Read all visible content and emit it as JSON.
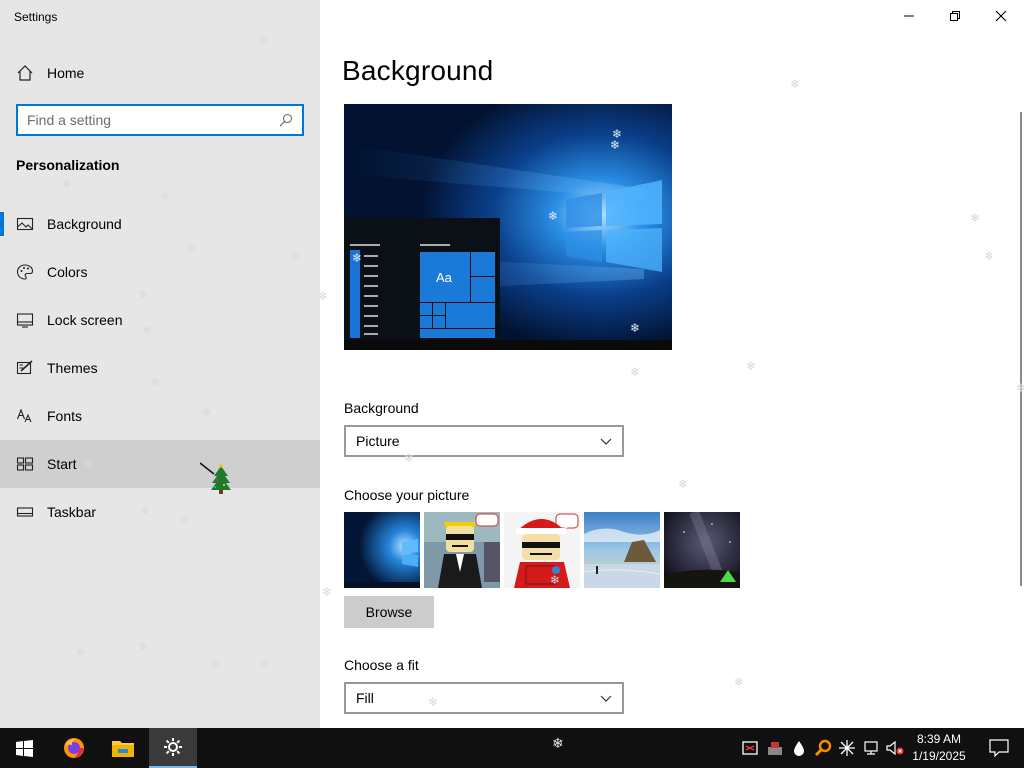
{
  "window": {
    "title": "Settings"
  },
  "sidebar": {
    "home_label": "Home",
    "search_placeholder": "Find a setting",
    "section_title": "Personalization",
    "items": [
      {
        "label": "Background",
        "icon": "picture-icon",
        "active": true
      },
      {
        "label": "Colors",
        "icon": "palette-icon"
      },
      {
        "label": "Lock screen",
        "icon": "lock-screen-icon"
      },
      {
        "label": "Themes",
        "icon": "brush-icon"
      },
      {
        "label": "Fonts",
        "icon": "fonts-icon"
      },
      {
        "label": "Start",
        "icon": "start-tiles-icon",
        "hover": true
      },
      {
        "label": "Taskbar",
        "icon": "taskbar-icon"
      }
    ]
  },
  "main": {
    "page_title": "Background",
    "background_label": "Background",
    "background_value": "Picture",
    "choose_picture_label": "Choose your picture",
    "thumbnails": [
      "windows-hero",
      "comic-character-suit",
      "comic-character-santa",
      "beach-sunset",
      "night-sky-tent"
    ],
    "browse_label": "Browse",
    "fit_label": "Choose a fit",
    "fit_value": "Fill",
    "preview_tile_text": "Aa"
  },
  "taskbar": {
    "time": "8:39 AM",
    "date": "1/19/2025",
    "apps": [
      "start-icon",
      "firefox-icon",
      "file-explorer-icon",
      "settings-icon"
    ],
    "tray": [
      "app-tray-icon",
      "network-app-icon",
      "droplet-icon",
      "search-magnifier-icon",
      "snowflake-icon",
      "network-icon",
      "volume-muted-icon",
      "notifications-icon"
    ]
  },
  "colors": {
    "accent": "#0078d7",
    "sidebar_bg": "#e6e6e6",
    "taskbar_bg": "#101010",
    "hover_bg": "#cfcfcf"
  }
}
